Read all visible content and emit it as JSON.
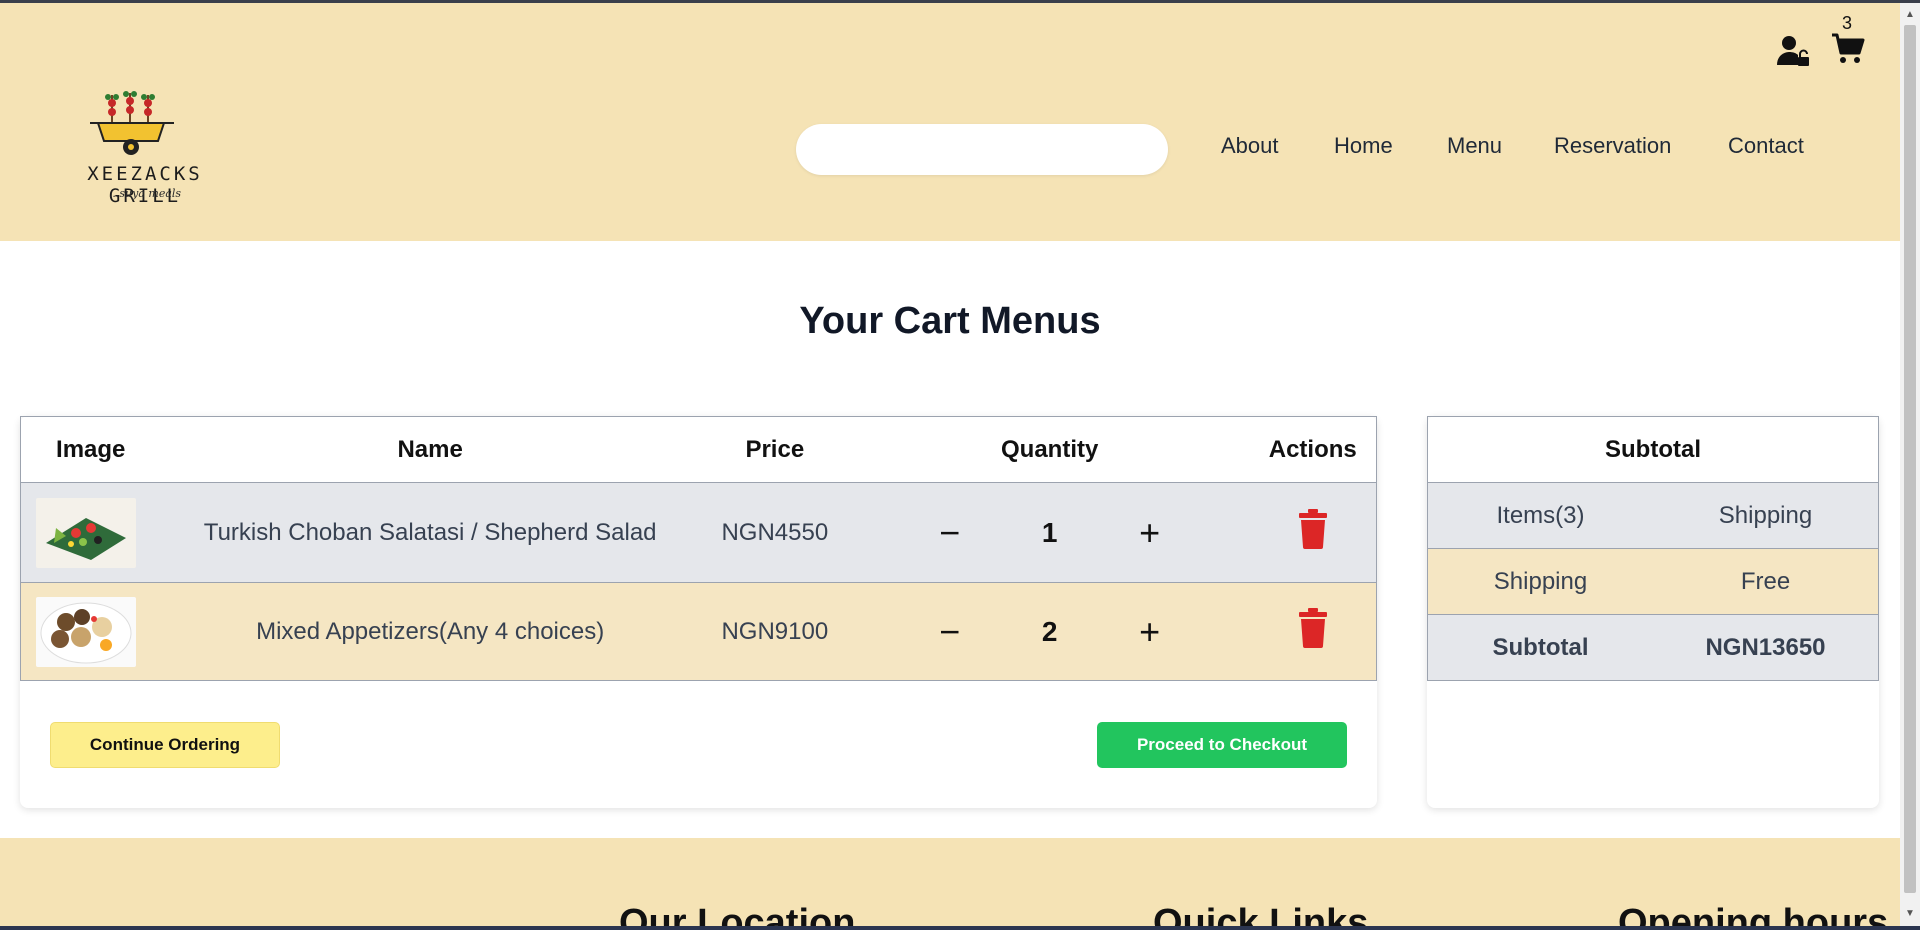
{
  "header": {
    "logo_text": "XEEZACKS GRILL",
    "logo_tagline": "...suya meals",
    "search_placeholder": "",
    "nav": [
      "About",
      "Home",
      "Menu",
      "Reservation",
      "Contact"
    ],
    "cart_count": "3",
    "icons": [
      "user-lock-icon",
      "cart-icon"
    ]
  },
  "page_title": "Your Cart Menus",
  "cart": {
    "columns": [
      "Image",
      "Name",
      "Price",
      "Quantity",
      "Actions"
    ],
    "items": [
      {
        "name": "Turkish Choban Salatasi / Shepherd Salad",
        "price": "NGN4550",
        "quantity": "1",
        "decrement": "−",
        "increment": "+"
      },
      {
        "name": "Mixed Appetizers(Any 4 choices)",
        "price": "NGN9100",
        "quantity": "2",
        "decrement": "−",
        "increment": "+"
      }
    ],
    "continue_label": "Continue Ordering",
    "checkout_label": "Proceed to Checkout"
  },
  "summary": {
    "title": "Subtotal",
    "rows": [
      [
        "Items(3)",
        "Shipping"
      ],
      [
        "Shipping",
        "Free"
      ],
      [
        "Subtotal",
        "NGN13650"
      ]
    ]
  },
  "footer": {
    "headings": [
      "Our Location",
      "Quick Links",
      "Opening hours"
    ]
  },
  "colors": {
    "header_bg": "#f5e3b5",
    "row_alt": "#f5e6c3",
    "row_gray": "#e5e7eb",
    "checkout": "#22c55e",
    "continue": "#fdee8c",
    "trash": "#dc2626"
  }
}
